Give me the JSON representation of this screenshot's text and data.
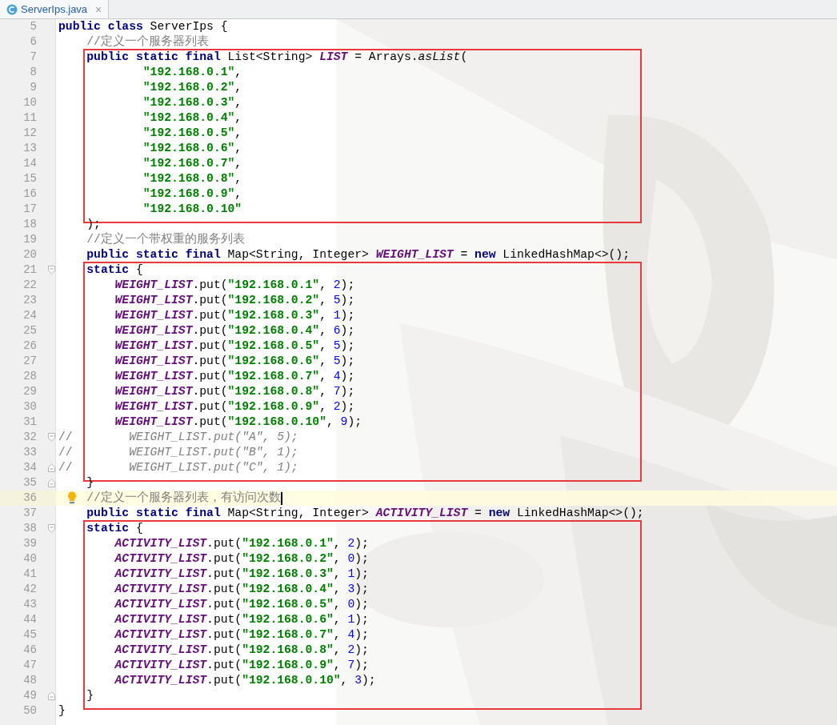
{
  "tabs": [
    {
      "label": "ServerIps.java",
      "close": "×",
      "selected": true
    }
  ],
  "editor": {
    "blocks": [
      {
        "boxed": false,
        "lines": [
          {
            "number": "5",
            "segments": [
              {
                "kind": "keyword",
                "text": "public class"
              },
              {
                "kind": "plain",
                "text": " ServerIps {"
              }
            ]
          },
          {
            "number": "6",
            "segments": [
              {
                "kind": "comment",
                "text": "    //定义一个服务器列表"
              }
            ]
          }
        ]
      },
      {
        "boxed": true,
        "lines": [
          {
            "number": "7",
            "segments": [
              {
                "kind": "keyword",
                "text": "    public static final"
              },
              {
                "kind": "plain",
                "text": " List<String> "
              },
              {
                "kind": "field",
                "text": "LIST"
              },
              {
                "kind": "plain",
                "text": " = Arrays."
              },
              {
                "kind": "static_call",
                "text": "asList"
              },
              {
                "kind": "plain",
                "text": "("
              }
            ]
          },
          {
            "number": "8",
            "segments": [
              {
                "kind": "string",
                "text": "            \"192.168.0.1\""
              },
              {
                "kind": "plain",
                "text": ","
              }
            ]
          },
          {
            "number": "9",
            "segments": [
              {
                "kind": "string",
                "text": "            \"192.168.0.2\""
              },
              {
                "kind": "plain",
                "text": ","
              }
            ]
          },
          {
            "number": "10",
            "segments": [
              {
                "kind": "string",
                "text": "            \"192.168.0.3\""
              },
              {
                "kind": "plain",
                "text": ","
              }
            ]
          },
          {
            "number": "11",
            "segments": [
              {
                "kind": "string",
                "text": "            \"192.168.0.4\""
              },
              {
                "kind": "plain",
                "text": ","
              }
            ]
          },
          {
            "number": "12",
            "segments": [
              {
                "kind": "string",
                "text": "            \"192.168.0.5\""
              },
              {
                "kind": "plain",
                "text": ","
              }
            ]
          },
          {
            "number": "13",
            "segments": [
              {
                "kind": "string",
                "text": "            \"192.168.0.6\""
              },
              {
                "kind": "plain",
                "text": ","
              }
            ]
          },
          {
            "number": "14",
            "segments": [
              {
                "kind": "string",
                "text": "            \"192.168.0.7\""
              },
              {
                "kind": "plain",
                "text": ","
              }
            ]
          },
          {
            "number": "15",
            "segments": [
              {
                "kind": "string",
                "text": "            \"192.168.0.8\""
              },
              {
                "kind": "plain",
                "text": ","
              }
            ]
          },
          {
            "number": "16",
            "segments": [
              {
                "kind": "string",
                "text": "            \"192.168.0.9\""
              },
              {
                "kind": "plain",
                "text": ","
              }
            ]
          },
          {
            "number": "17",
            "segments": [
              {
                "kind": "string",
                "text": "            \"192.168.0.10\""
              }
            ]
          }
        ]
      },
      {
        "boxed": false,
        "lines": [
          {
            "number": "18",
            "segments": [
              {
                "kind": "plain",
                "text": "    );"
              }
            ]
          },
          {
            "number": "19",
            "segments": [
              {
                "kind": "comment",
                "text": "    //定义一个带权重的服务列表"
              }
            ]
          },
          {
            "number": "20",
            "segments": [
              {
                "kind": "keyword",
                "text": "    public static final"
              },
              {
                "kind": "plain",
                "text": " Map<String, Integer> "
              },
              {
                "kind": "field",
                "text": "WEIGHT_LIST"
              },
              {
                "kind": "plain",
                "text": " = "
              },
              {
                "kind": "keyword",
                "text": "new"
              },
              {
                "kind": "plain",
                "text": " LinkedHashMap<>();"
              }
            ]
          }
        ]
      },
      {
        "boxed": true,
        "lines": [
          {
            "number": "21",
            "fold_start": true,
            "segments": [
              {
                "kind": "keyword",
                "text": "    static"
              },
              {
                "kind": "plain",
                "text": " {"
              }
            ]
          },
          {
            "number": "22",
            "segments": [
              {
                "kind": "field",
                "text": "        WEIGHT_LIST"
              },
              {
                "kind": "plain",
                "text": ".put("
              },
              {
                "kind": "string",
                "text": "\"192.168.0.1\""
              },
              {
                "kind": "plain",
                "text": ", "
              },
              {
                "kind": "number",
                "text": "2"
              },
              {
                "kind": "plain",
                "text": ");"
              }
            ]
          },
          {
            "number": "23",
            "segments": [
              {
                "kind": "field",
                "text": "        WEIGHT_LIST"
              },
              {
                "kind": "plain",
                "text": ".put("
              },
              {
                "kind": "string",
                "text": "\"192.168.0.2\""
              },
              {
                "kind": "plain",
                "text": ", "
              },
              {
                "kind": "number",
                "text": "5"
              },
              {
                "kind": "plain",
                "text": ");"
              }
            ]
          },
          {
            "number": "24",
            "segments": [
              {
                "kind": "field",
                "text": "        WEIGHT_LIST"
              },
              {
                "kind": "plain",
                "text": ".put("
              },
              {
                "kind": "string",
                "text": "\"192.168.0.3\""
              },
              {
                "kind": "plain",
                "text": ", "
              },
              {
                "kind": "number",
                "text": "1"
              },
              {
                "kind": "plain",
                "text": ");"
              }
            ]
          },
          {
            "number": "25",
            "segments": [
              {
                "kind": "field",
                "text": "        WEIGHT_LIST"
              },
              {
                "kind": "plain",
                "text": ".put("
              },
              {
                "kind": "string",
                "text": "\"192.168.0.4\""
              },
              {
                "kind": "plain",
                "text": ", "
              },
              {
                "kind": "number",
                "text": "6"
              },
              {
                "kind": "plain",
                "text": ");"
              }
            ]
          },
          {
            "number": "26",
            "segments": [
              {
                "kind": "field",
                "text": "        WEIGHT_LIST"
              },
              {
                "kind": "plain",
                "text": ".put("
              },
              {
                "kind": "string",
                "text": "\"192.168.0.5\""
              },
              {
                "kind": "plain",
                "text": ", "
              },
              {
                "kind": "number",
                "text": "5"
              },
              {
                "kind": "plain",
                "text": ");"
              }
            ]
          },
          {
            "number": "27",
            "segments": [
              {
                "kind": "field",
                "text": "        WEIGHT_LIST"
              },
              {
                "kind": "plain",
                "text": ".put("
              },
              {
                "kind": "string",
                "text": "\"192.168.0.6\""
              },
              {
                "kind": "plain",
                "text": ", "
              },
              {
                "kind": "number",
                "text": "5"
              },
              {
                "kind": "plain",
                "text": ");"
              }
            ]
          },
          {
            "number": "28",
            "segments": [
              {
                "kind": "field",
                "text": "        WEIGHT_LIST"
              },
              {
                "kind": "plain",
                "text": ".put("
              },
              {
                "kind": "string",
                "text": "\"192.168.0.7\""
              },
              {
                "kind": "plain",
                "text": ", "
              },
              {
                "kind": "number",
                "text": "4"
              },
              {
                "kind": "plain",
                "text": ");"
              }
            ]
          },
          {
            "number": "29",
            "segments": [
              {
                "kind": "field",
                "text": "        WEIGHT_LIST"
              },
              {
                "kind": "plain",
                "text": ".put("
              },
              {
                "kind": "string",
                "text": "\"192.168.0.8\""
              },
              {
                "kind": "plain",
                "text": ", "
              },
              {
                "kind": "number",
                "text": "7"
              },
              {
                "kind": "plain",
                "text": ");"
              }
            ]
          },
          {
            "number": "30",
            "segments": [
              {
                "kind": "field",
                "text": "        WEIGHT_LIST"
              },
              {
                "kind": "plain",
                "text": ".put("
              },
              {
                "kind": "string",
                "text": "\"192.168.0.9\""
              },
              {
                "kind": "plain",
                "text": ", "
              },
              {
                "kind": "number",
                "text": "2"
              },
              {
                "kind": "plain",
                "text": ");"
              }
            ]
          },
          {
            "number": "31",
            "segments": [
              {
                "kind": "field",
                "text": "        WEIGHT_LIST"
              },
              {
                "kind": "plain",
                "text": ".put("
              },
              {
                "kind": "string",
                "text": "\"192.168.0.10\""
              },
              {
                "kind": "plain",
                "text": ", "
              },
              {
                "kind": "number",
                "text": "9"
              },
              {
                "kind": "plain",
                "text": ");"
              }
            ]
          },
          {
            "number": "32",
            "fold_start": true,
            "segments": [
              {
                "kind": "comment",
                "text": "//"
              },
              {
                "kind": "disabled_code",
                "text": "        WEIGHT_LIST.put(\"A\", 5);"
              }
            ]
          },
          {
            "number": "33",
            "segments": [
              {
                "kind": "comment",
                "text": "//"
              },
              {
                "kind": "disabled_code",
                "text": "        WEIGHT_LIST.put(\"B\", 1);"
              }
            ]
          },
          {
            "number": "34",
            "fold_end": true,
            "segments": [
              {
                "kind": "comment",
                "text": "//"
              },
              {
                "kind": "disabled_code",
                "text": "        WEIGHT_LIST.put(\"C\", 1);"
              }
            ]
          }
        ]
      },
      {
        "boxed": false,
        "lines": [
          {
            "number": "35",
            "fold_end": true,
            "segments": [
              {
                "kind": "plain",
                "text": "    }"
              }
            ]
          },
          {
            "number": "36",
            "current": true,
            "bulb": true,
            "caret": true,
            "segments": [
              {
                "kind": "comment",
                "text": "//定义一个服务器列表，有访问次数"
              }
            ]
          },
          {
            "number": "37",
            "segments": [
              {
                "kind": "keyword",
                "text": "    public static final"
              },
              {
                "kind": "plain",
                "text": " Map<String, Integer> "
              },
              {
                "kind": "field",
                "text": "ACTIVITY_LIST"
              },
              {
                "kind": "plain",
                "text": " = "
              },
              {
                "kind": "keyword",
                "text": "new"
              },
              {
                "kind": "plain",
                "text": " LinkedHashMap<>();"
              }
            ]
          }
        ]
      },
      {
        "boxed": true,
        "lines": [
          {
            "number": "38",
            "fold_start": true,
            "segments": [
              {
                "kind": "keyword",
                "text": "    static"
              },
              {
                "kind": "plain",
                "text": " {"
              }
            ]
          },
          {
            "number": "39",
            "segments": [
              {
                "kind": "field",
                "text": "        ACTIVITY_LIST"
              },
              {
                "kind": "plain",
                "text": ".put("
              },
              {
                "kind": "string",
                "text": "\"192.168.0.1\""
              },
              {
                "kind": "plain",
                "text": ", "
              },
              {
                "kind": "number",
                "text": "2"
              },
              {
                "kind": "plain",
                "text": ");"
              }
            ]
          },
          {
            "number": "40",
            "segments": [
              {
                "kind": "field",
                "text": "        ACTIVITY_LIST"
              },
              {
                "kind": "plain",
                "text": ".put("
              },
              {
                "kind": "string",
                "text": "\"192.168.0.2\""
              },
              {
                "kind": "plain",
                "text": ", "
              },
              {
                "kind": "number",
                "text": "0"
              },
              {
                "kind": "plain",
                "text": ");"
              }
            ]
          },
          {
            "number": "41",
            "segments": [
              {
                "kind": "field",
                "text": "        ACTIVITY_LIST"
              },
              {
                "kind": "plain",
                "text": ".put("
              },
              {
                "kind": "string",
                "text": "\"192.168.0.3\""
              },
              {
                "kind": "plain",
                "text": ", "
              },
              {
                "kind": "number",
                "text": "1"
              },
              {
                "kind": "plain",
                "text": ");"
              }
            ]
          },
          {
            "number": "42",
            "segments": [
              {
                "kind": "field",
                "text": "        ACTIVITY_LIST"
              },
              {
                "kind": "plain",
                "text": ".put("
              },
              {
                "kind": "string",
                "text": "\"192.168.0.4\""
              },
              {
                "kind": "plain",
                "text": ", "
              },
              {
                "kind": "number",
                "text": "3"
              },
              {
                "kind": "plain",
                "text": ");"
              }
            ]
          },
          {
            "number": "43",
            "segments": [
              {
                "kind": "field",
                "text": "        ACTIVITY_LIST"
              },
              {
                "kind": "plain",
                "text": ".put("
              },
              {
                "kind": "string",
                "text": "\"192.168.0.5\""
              },
              {
                "kind": "plain",
                "text": ", "
              },
              {
                "kind": "number",
                "text": "0"
              },
              {
                "kind": "plain",
                "text": ");"
              }
            ]
          },
          {
            "number": "44",
            "segments": [
              {
                "kind": "field",
                "text": "        ACTIVITY_LIST"
              },
              {
                "kind": "plain",
                "text": ".put("
              },
              {
                "kind": "string",
                "text": "\"192.168.0.6\""
              },
              {
                "kind": "plain",
                "text": ", "
              },
              {
                "kind": "number",
                "text": "1"
              },
              {
                "kind": "plain",
                "text": ");"
              }
            ]
          },
          {
            "number": "45",
            "segments": [
              {
                "kind": "field",
                "text": "        ACTIVITY_LIST"
              },
              {
                "kind": "plain",
                "text": ".put("
              },
              {
                "kind": "string",
                "text": "\"192.168.0.7\""
              },
              {
                "kind": "plain",
                "text": ", "
              },
              {
                "kind": "number",
                "text": "4"
              },
              {
                "kind": "plain",
                "text": ");"
              }
            ]
          },
          {
            "number": "46",
            "segments": [
              {
                "kind": "field",
                "text": "        ACTIVITY_LIST"
              },
              {
                "kind": "plain",
                "text": ".put("
              },
              {
                "kind": "string",
                "text": "\"192.168.0.8\""
              },
              {
                "kind": "plain",
                "text": ", "
              },
              {
                "kind": "number",
                "text": "2"
              },
              {
                "kind": "plain",
                "text": ");"
              }
            ]
          },
          {
            "number": "47",
            "segments": [
              {
                "kind": "field",
                "text": "        ACTIVITY_LIST"
              },
              {
                "kind": "plain",
                "text": ".put("
              },
              {
                "kind": "string",
                "text": "\"192.168.0.9\""
              },
              {
                "kind": "plain",
                "text": ", "
              },
              {
                "kind": "number",
                "text": "7"
              },
              {
                "kind": "plain",
                "text": ");"
              }
            ]
          },
          {
            "number": "48",
            "segments": [
              {
                "kind": "field",
                "text": "        ACTIVITY_LIST"
              },
              {
                "kind": "plain",
                "text": ".put("
              },
              {
                "kind": "string",
                "text": "\"192.168.0.10\""
              },
              {
                "kind": "plain",
                "text": ", "
              },
              {
                "kind": "number",
                "text": "3"
              },
              {
                "kind": "plain",
                "text": ");"
              }
            ]
          },
          {
            "number": "49",
            "fold_end": true,
            "segments": [
              {
                "kind": "plain",
                "text": "    }"
              }
            ]
          }
        ]
      },
      {
        "boxed": false,
        "lines": [
          {
            "number": "50",
            "segments": [
              {
                "kind": "plain",
                "text": "}"
              }
            ]
          }
        ]
      }
    ]
  }
}
